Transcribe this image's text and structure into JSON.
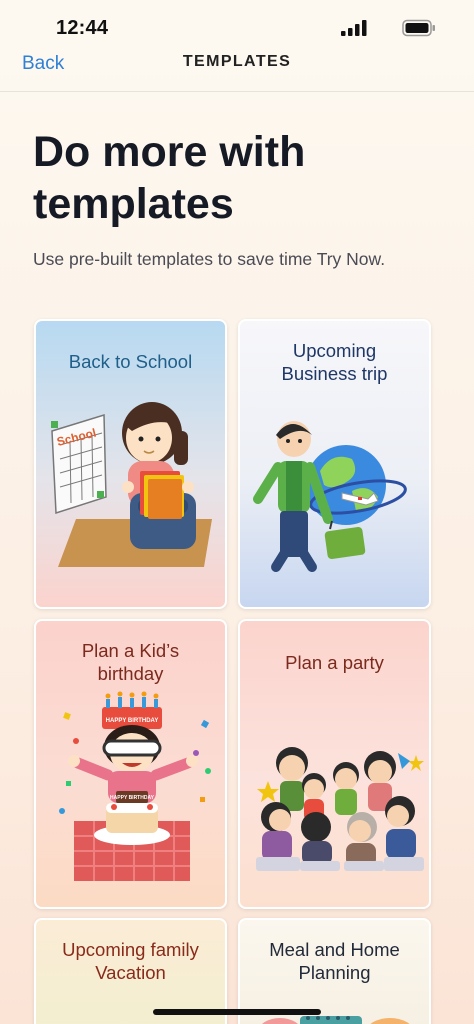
{
  "status_bar": {
    "time": "12:44"
  },
  "nav": {
    "back_label": "Back",
    "title": "TEMPLATES"
  },
  "main": {
    "heading": "Do more with templates",
    "subtitle": "Use pre-built templates to save time Try Now."
  },
  "templates": [
    {
      "title_lines": [
        "Back to School"
      ],
      "sign_text": "School"
    },
    {
      "title_lines": [
        "Upcoming",
        "Business trip"
      ]
    },
    {
      "title_lines": [
        "Plan a Kid’s",
        "birthday"
      ],
      "hat_text": "HAPPY BIRTHDAY",
      "cake_text": "HAPPY BIRTHDAY"
    },
    {
      "title_lines": [
        "Plan a party"
      ]
    },
    {
      "title_lines": [
        "Upcoming family",
        "Vacation"
      ]
    },
    {
      "title_lines": [
        "Meal and Home",
        "Planning"
      ]
    }
  ],
  "colors": {
    "accent": "#2f80d6",
    "heading": "#161a25"
  },
  "icons": [
    "signal-icon",
    "battery-icon"
  ]
}
